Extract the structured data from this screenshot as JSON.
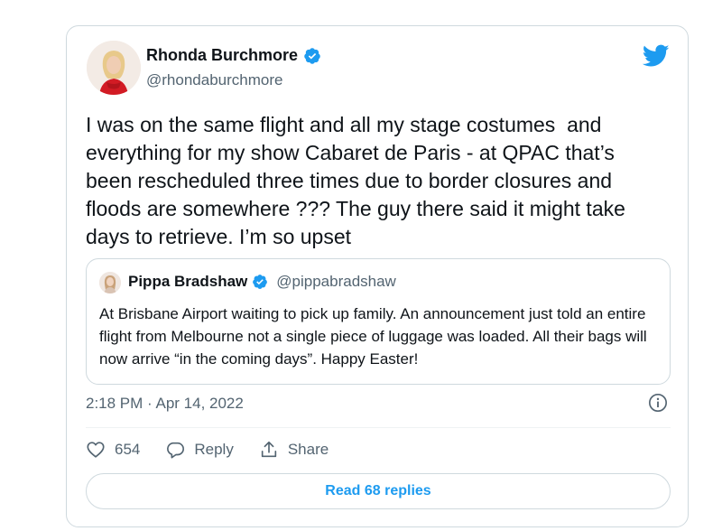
{
  "author": {
    "name": "Rhonda Burchmore",
    "handle": "@rhondaburchmore"
  },
  "tweet": {
    "text": "I was on the same flight and all my stage costumes  and\neverything for my show Cabaret de Paris - at QPAC that’s\nbeen rescheduled three times due to border closures and\nfloods are somewhere ??? The guy there said it might take\ndays to retrieve. I’m so upset"
  },
  "quoted": {
    "name": "Pippa Bradshaw",
    "handle": "@pippabradshaw",
    "text": "At Brisbane Airport waiting to pick up family. An announcement just told an entire flight from Melbourne not a single piece of luggage was loaded. All their bags will now arrive “in the coming days”. Happy Easter!"
  },
  "meta": {
    "timestamp": "2:18 PM · Apr 14, 2022"
  },
  "actions": {
    "likes": "654",
    "reply_label": "Reply",
    "share_label": "Share"
  },
  "read_replies": "Read 68 replies",
  "colors": {
    "accent": "#1d9bf0",
    "text": "#0f1419",
    "muted": "#536471",
    "border": "#cfd9de"
  },
  "icons": [
    "twitter-bird-icon",
    "verified-badge-icon",
    "info-icon",
    "heart-icon",
    "reply-icon",
    "share-icon"
  ]
}
